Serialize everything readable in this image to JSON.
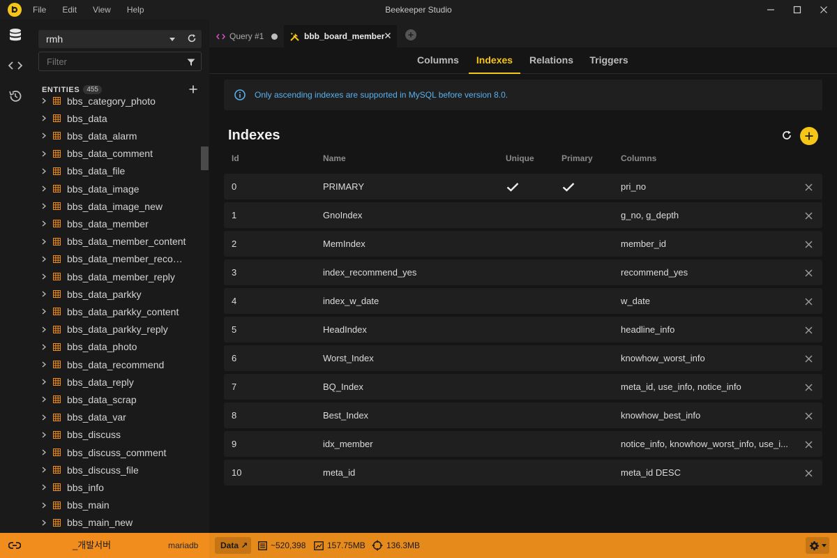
{
  "window": {
    "title": "Beekeeper Studio",
    "menu": [
      "File",
      "Edit",
      "View",
      "Help"
    ]
  },
  "sidebar": {
    "connection": "rmh",
    "filter_placeholder": "Filter",
    "entities_label": "ENTITIES",
    "entities_count": "455",
    "entities": [
      "bbs_category_photo",
      "bbs_data",
      "bbs_data_alarm",
      "bbs_data_comment",
      "bbs_data_file",
      "bbs_data_image",
      "bbs_data_image_new",
      "bbs_data_member",
      "bbs_data_member_content",
      "bbs_data_member_recom...",
      "bbs_data_member_reply",
      "bbs_data_parkky",
      "bbs_data_parkky_content",
      "bbs_data_parkky_reply",
      "bbs_data_photo",
      "bbs_data_recommend",
      "bbs_data_reply",
      "bbs_data_scrap",
      "bbs_data_var",
      "bbs_discuss",
      "bbs_discuss_comment",
      "bbs_discuss_file",
      "bbs_info",
      "bbs_main",
      "bbs_main_new"
    ]
  },
  "tabs": [
    {
      "label": "Query #1"
    },
    {
      "label": "bbb_board_member"
    }
  ],
  "subtabs": [
    "Columns",
    "Indexes",
    "Relations",
    "Triggers"
  ],
  "active_subtab": "Indexes",
  "info": "Only ascending indexes are supported in MySQL before version 8.0.",
  "section_title": "Indexes",
  "table": {
    "headers": {
      "id": "Id",
      "name": "Name",
      "unique": "Unique",
      "primary": "Primary",
      "columns": "Columns"
    },
    "rows": [
      {
        "id": "0",
        "name": "PRIMARY",
        "unique": true,
        "primary": true,
        "columns": "pri_no"
      },
      {
        "id": "1",
        "name": "GnoIndex",
        "unique": false,
        "primary": false,
        "columns": "g_no, g_depth"
      },
      {
        "id": "2",
        "name": "MemIndex",
        "unique": false,
        "primary": false,
        "columns": "member_id"
      },
      {
        "id": "3",
        "name": "index_recommend_yes",
        "unique": false,
        "primary": false,
        "columns": "recommend_yes"
      },
      {
        "id": "4",
        "name": "index_w_date",
        "unique": false,
        "primary": false,
        "columns": "w_date"
      },
      {
        "id": "5",
        "name": "HeadIndex",
        "unique": false,
        "primary": false,
        "columns": "headline_info"
      },
      {
        "id": "6",
        "name": "Worst_Index",
        "unique": false,
        "primary": false,
        "columns": "knowhow_worst_info"
      },
      {
        "id": "7",
        "name": "BQ_Index",
        "unique": false,
        "primary": false,
        "columns": "meta_id, use_info, notice_info"
      },
      {
        "id": "8",
        "name": "Best_Index",
        "unique": false,
        "primary": false,
        "columns": "knowhow_best_info"
      },
      {
        "id": "9",
        "name": "idx_member",
        "unique": false,
        "primary": false,
        "columns": "notice_info, knowhow_worst_info, use_i..."
      },
      {
        "id": "10",
        "name": "meta_id",
        "unique": false,
        "primary": false,
        "columns": "meta_id DESC"
      }
    ]
  },
  "statusbar": {
    "connection_name": "_개발서버",
    "connection_type": "mariadb",
    "data_label": "Data ↗",
    "row_count": "~520,398",
    "data_size": "157.75MB",
    "index_size": "136.3MB"
  },
  "colors": {
    "accent": "#f5c518",
    "statusbar": "#e58a1b",
    "info_text": "#5ab0ec"
  }
}
